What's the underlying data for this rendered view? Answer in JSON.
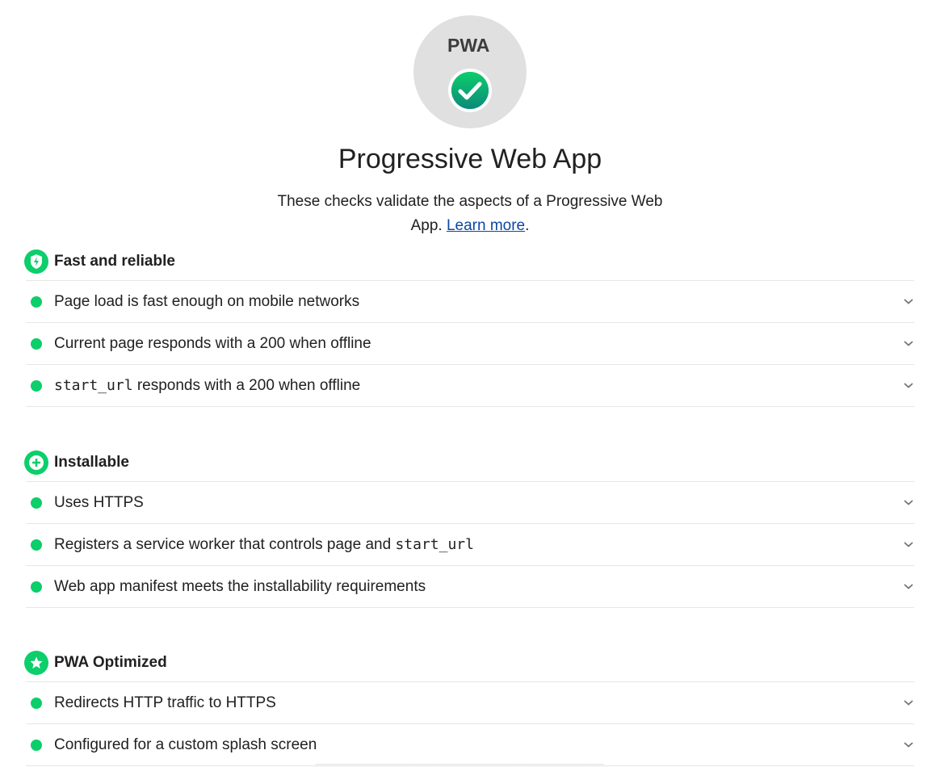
{
  "header": {
    "logo_text": "PWA",
    "title": "Progressive Web App",
    "description_text": "These checks validate the aspects of a Progressive Web App. ",
    "learn_more_label": "Learn more",
    "description_end": "."
  },
  "colors": {
    "pass_green": "#0cce6b",
    "badge_green": "#0f9d58",
    "link_blue": "#0d47a1",
    "gauge_gray": "#e0e0e0"
  },
  "groups": [
    {
      "title": "Fast and reliable",
      "icon": "shield-bolt-icon",
      "audits": [
        {
          "label": "Page load is fast enough on mobile networks"
        },
        {
          "label": "Current page responds with a 200 when offline"
        },
        {
          "code": "start_url",
          "label": " responds with a 200 when offline"
        }
      ]
    },
    {
      "title": "Installable",
      "icon": "plus-circle-icon",
      "audits": [
        {
          "label": "Uses HTTPS"
        },
        {
          "label": "Registers a service worker that controls page and ",
          "code": "start_url"
        },
        {
          "label": "Web app manifest meets the installability requirements"
        }
      ]
    },
    {
      "title": "PWA Optimized",
      "icon": "star-icon",
      "audits": [
        {
          "label": "Redirects HTTP traffic to HTTPS"
        },
        {
          "label": "Configured for a custom splash screen"
        }
      ]
    }
  ]
}
